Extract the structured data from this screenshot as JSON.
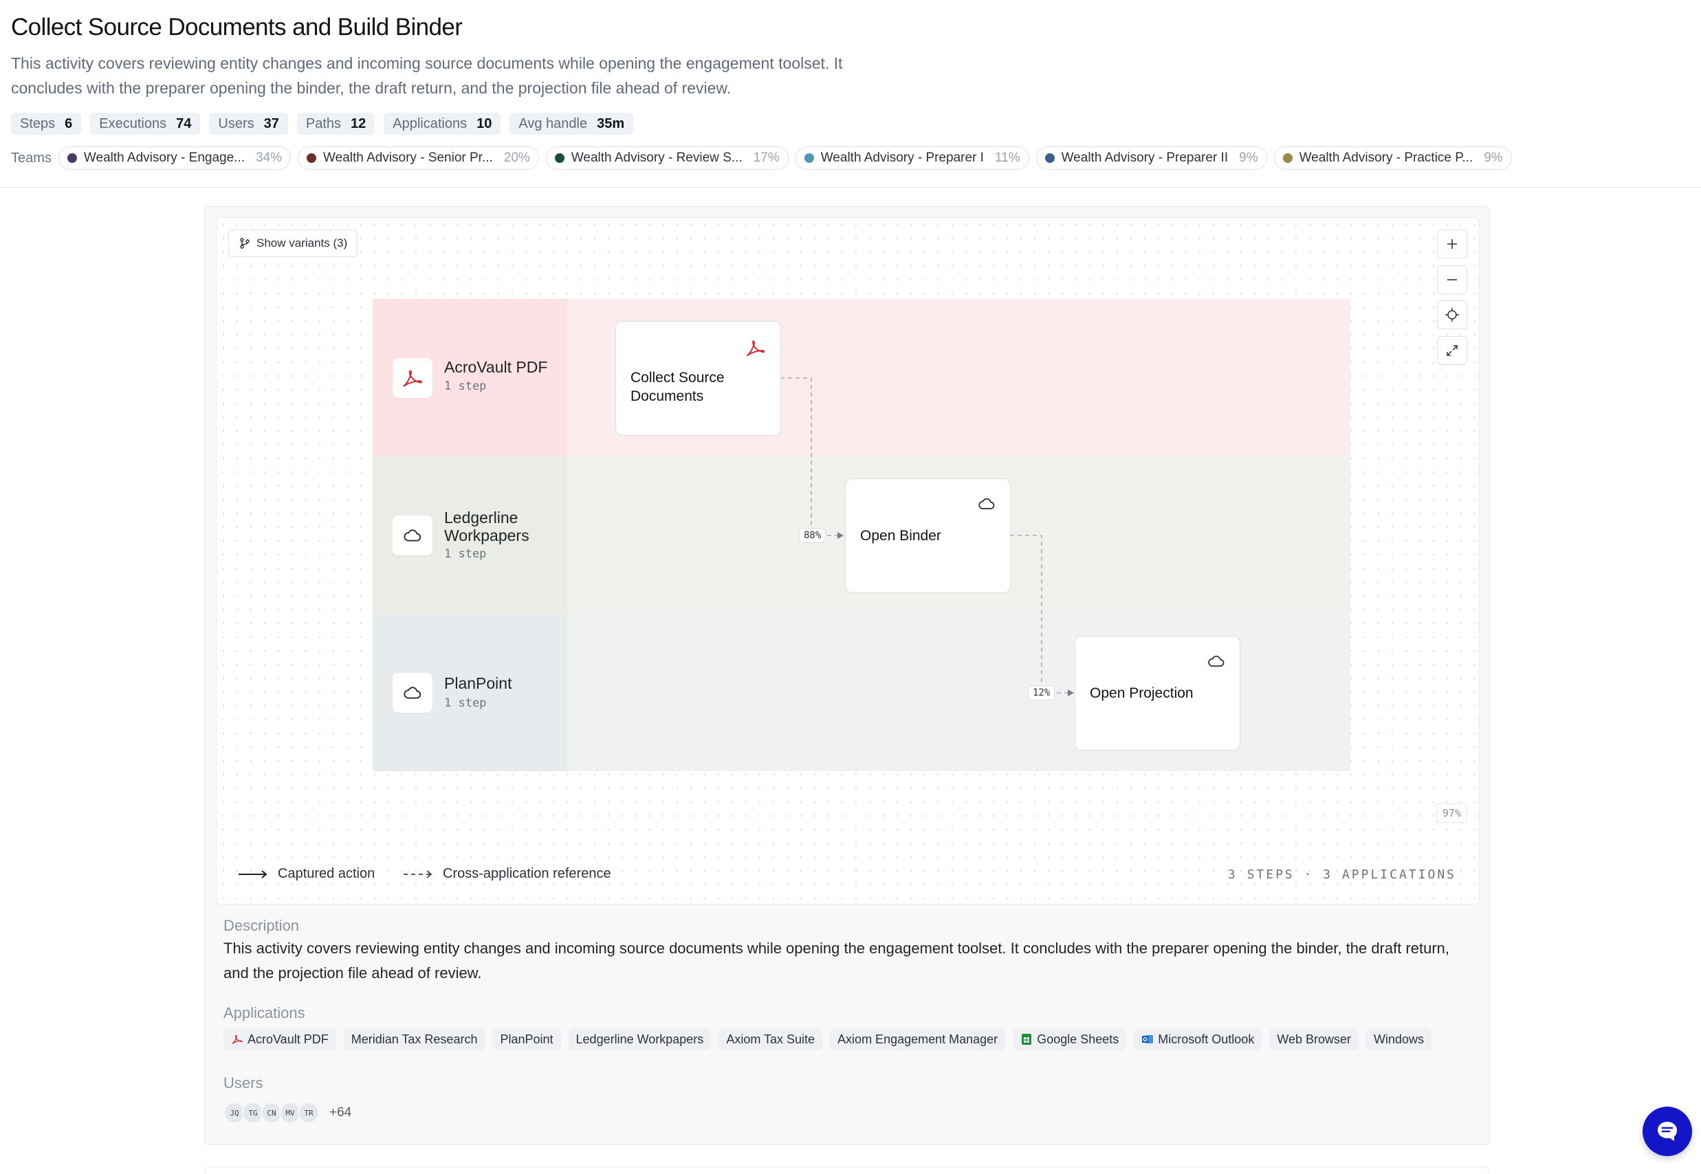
{
  "header": {
    "title": "Collect Source Documents and Build Binder",
    "description": "This activity covers reviewing entity changes and incoming source documents while opening the engagement toolset. It concludes with the preparer opening the binder, the draft return, and the projection file ahead of review."
  },
  "stats": [
    {
      "label": "Steps",
      "value": "6"
    },
    {
      "label": "Executions",
      "value": "74"
    },
    {
      "label": "Users",
      "value": "37"
    },
    {
      "label": "Paths",
      "value": "12"
    },
    {
      "label": "Applications",
      "value": "10"
    },
    {
      "label": "Avg handle",
      "value": "35m"
    }
  ],
  "teams": {
    "label": "Teams",
    "items": [
      {
        "name": "Wealth Advisory - Engage...",
        "pct": "34%",
        "color": "#4a3a66"
      },
      {
        "name": "Wealth Advisory - Senior Pr...",
        "pct": "20%",
        "color": "#6b2f2f"
      },
      {
        "name": "Wealth Advisory - Review S...",
        "pct": "17%",
        "color": "#1f4a3c"
      },
      {
        "name": "Wealth Advisory - Preparer I",
        "pct": "11%",
        "color": "#4a9ab0"
      },
      {
        "name": "Wealth Advisory - Preparer II",
        "pct": "9%",
        "color": "#3a5f8a"
      },
      {
        "name": "Wealth Advisory - Practice P...",
        "pct": "9%",
        "color": "#9a8a48"
      }
    ]
  },
  "canvas": {
    "variants_label": "Show variants (3)",
    "zoom_level": "97%",
    "controls": [
      "plus-icon",
      "minus-icon",
      "crosshair-icon",
      "expand-icon"
    ]
  },
  "lanes": [
    {
      "name": "AcroVault PDF",
      "steps": "1 step",
      "icon": "pdf-icon",
      "head_color": "#fde2e5",
      "body_color": "#fdecee"
    },
    {
      "name": "Ledgerline Workpapers",
      "name_lines": [
        "Ledgerline",
        "Workpapers"
      ],
      "steps": "1 step",
      "icon": "cloud-icon",
      "head_color": "#e9ede6",
      "body_color": "#f0f2ee"
    },
    {
      "name": "PlanPoint",
      "steps": "1 step",
      "icon": "cloud-icon",
      "head_color": "#e7ebed",
      "body_color": "#eff1f3"
    }
  ],
  "nodes": [
    {
      "label_lines": [
        "Collect Source",
        "Documents"
      ],
      "icon": "pdf-icon"
    },
    {
      "label_lines": [
        "Open Binder"
      ],
      "icon": "cloud-icon"
    },
    {
      "label_lines": [
        "Open Projection"
      ],
      "icon": "cloud-icon"
    }
  ],
  "edges": [
    {
      "from": "Collect Source Documents",
      "to": "Open Binder",
      "pct": "88%"
    },
    {
      "from": "Open Binder",
      "to": "Open Projection",
      "pct": "12%"
    }
  ],
  "legend": {
    "captured": "Captured action",
    "cross": "Cross-application reference",
    "summary": "3 STEPS · 3 APPLICATIONS"
  },
  "details": {
    "description_label": "Description",
    "description": "This activity covers reviewing entity changes and incoming source documents while opening the engagement toolset. It concludes with the preparer opening the binder, the draft return, and the projection file ahead of review.",
    "applications_label": "Applications",
    "applications": [
      {
        "name": "AcroVault PDF",
        "icon": "pdf-icon"
      },
      {
        "name": "Meridian Tax Research",
        "icon": ""
      },
      {
        "name": "PlanPoint",
        "icon": ""
      },
      {
        "name": "Ledgerline Workpapers",
        "icon": ""
      },
      {
        "name": "Axiom Tax Suite",
        "icon": ""
      },
      {
        "name": "Axiom Engagement Manager",
        "icon": ""
      },
      {
        "name": "Google Sheets",
        "icon": "sheets-icon"
      },
      {
        "name": "Microsoft Outlook",
        "icon": "outlook-icon"
      },
      {
        "name": "Web Browser",
        "icon": ""
      },
      {
        "name": "Windows",
        "icon": ""
      }
    ],
    "users_label": "Users",
    "users": [
      "JQ",
      "TG",
      "CN",
      "MV",
      "TR"
    ],
    "users_more": "+64"
  }
}
